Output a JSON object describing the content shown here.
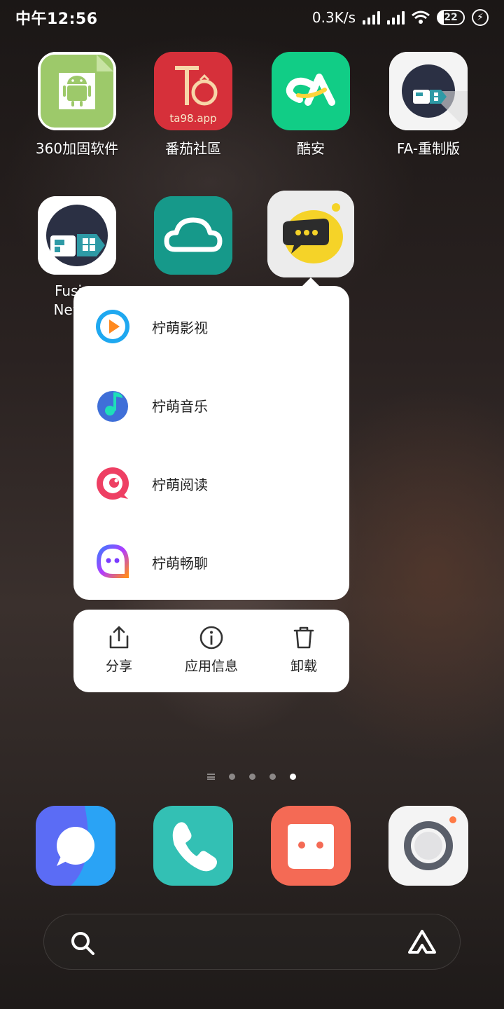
{
  "status_bar": {
    "time": "中午12:56",
    "net_speed": "0.3K/s",
    "battery": "22"
  },
  "apps_row1": [
    {
      "label": "360加固软件",
      "icon": "android-icon"
    },
    {
      "label": "番茄社區",
      "icon": "tomato-icon",
      "badge_text": "ta98.app"
    },
    {
      "label": "酷安",
      "icon": "coolapk-icon"
    },
    {
      "label": "FA-重制版",
      "icon": "fa-icon"
    }
  ],
  "apps_row2": [
    {
      "label_line1": "Fusion",
      "label_line2": "NewLu",
      "icon": "fusion-icon"
    },
    {
      "label": "",
      "icon": "cloud-icon"
    },
    {
      "label": "",
      "icon": "lemon-chat-icon"
    }
  ],
  "popup": {
    "shortcuts": [
      {
        "label": "柠萌影视",
        "icon": "play-icon"
      },
      {
        "label": "柠萌音乐",
        "icon": "music-note-icon"
      },
      {
        "label": "柠萌阅读",
        "icon": "reading-icon"
      },
      {
        "label": "柠萌畅聊",
        "icon": "chat-face-icon"
      }
    ],
    "actions": [
      {
        "label": "分享",
        "icon": "share-icon"
      },
      {
        "label": "应用信息",
        "icon": "info-icon"
      },
      {
        "label": "卸载",
        "icon": "trash-icon"
      }
    ]
  },
  "dock": [
    {
      "icon": "messages-icon"
    },
    {
      "icon": "phone-icon"
    },
    {
      "icon": "chat-bubble-icon"
    },
    {
      "icon": "camera-icon"
    }
  ],
  "search": {
    "icon": "search-icon",
    "assistant_icon": "assistant-icon"
  },
  "colors": {
    "coolapk_green": "#11cd86",
    "cloud_teal": "#1a9f8a",
    "tomato_red": "#d6303a",
    "popup_bg": "#ffffff"
  }
}
